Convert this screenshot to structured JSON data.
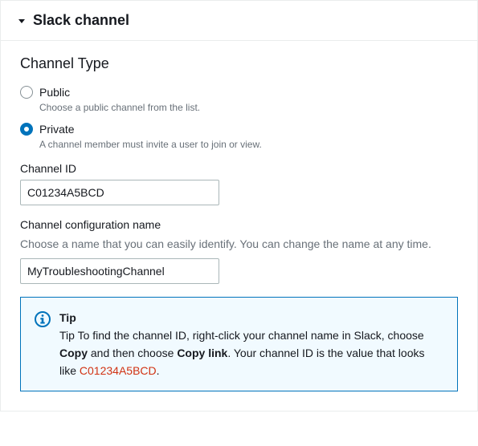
{
  "panel": {
    "title": "Slack channel"
  },
  "channelType": {
    "heading": "Channel Type",
    "public": {
      "label": "Public",
      "description": "Choose a public channel from the list."
    },
    "private": {
      "label": "Private",
      "description": "A channel member must invite a user to join or view."
    }
  },
  "channelId": {
    "label": "Channel ID",
    "value": "C01234A5BCD"
  },
  "configName": {
    "label": "Channel configuration name",
    "description": "Choose a name that you can easily identify. You can change the name at any time.",
    "value": "MyTroubleshootingChannel"
  },
  "tip": {
    "title": "Tip",
    "prefix": "Tip To find the channel ID, right-click your channel name in Slack, choose ",
    "copy": "Copy",
    "middle": " and then choose ",
    "copylink": "Copy link",
    "after": ". Your channel ID is the value that looks like ",
    "code": "C01234A5BCD",
    "suffix": "."
  }
}
